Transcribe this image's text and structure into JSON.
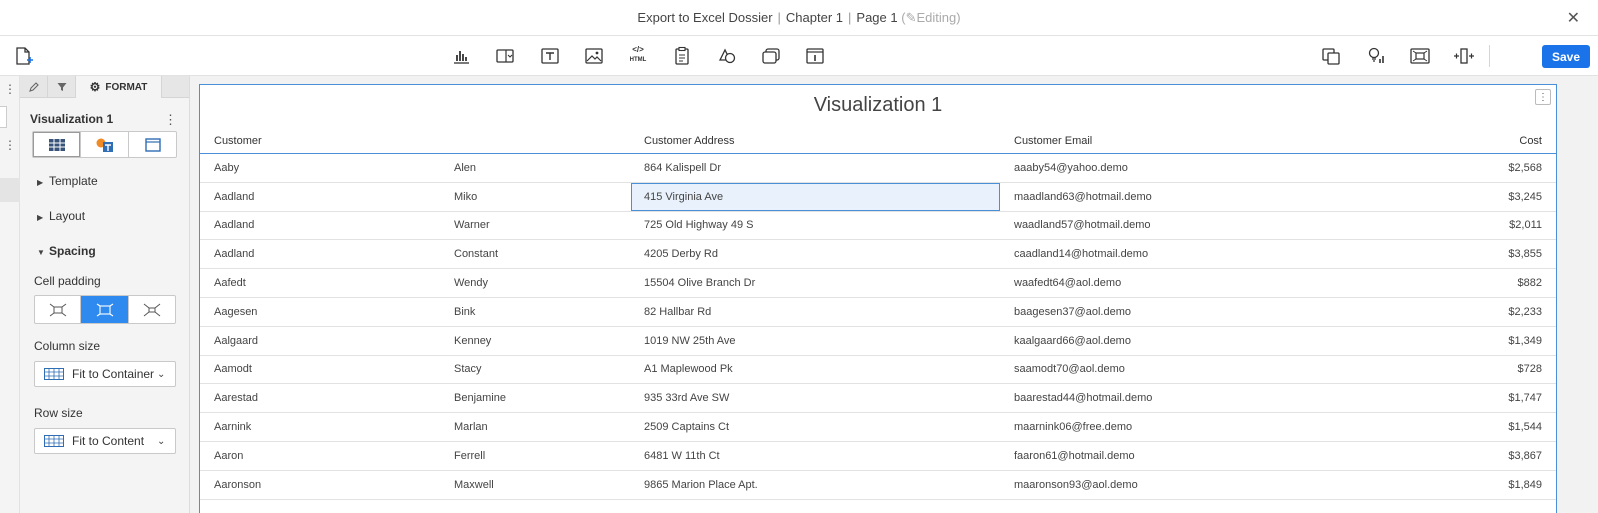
{
  "titlebar": {
    "dossier": "Export to Excel Dossier",
    "chapter": "Chapter 1",
    "page": "Page 1",
    "status": "Editing",
    "separator": "|",
    "close_icon": "close-icon"
  },
  "toolbar": {
    "save_label": "Save",
    "icons": [
      "new-page-icon",
      "chart-icon",
      "filter-selector-icon",
      "text-icon",
      "image-icon",
      "html-icon",
      "clipboard-icon",
      "shape-icon",
      "panel-stack-icon",
      "info-window-icon",
      "duplicate-icon",
      "bulb-insights-icon",
      "fit-to-window-icon",
      "insert-column-icon"
    ],
    "html_icon_text": "</>",
    "html_icon_sub": "HTML"
  },
  "panel": {
    "tabs": {
      "edit": "edit-icon",
      "filter": "filter-icon",
      "format_label": "FORMAT"
    },
    "heading": "Visualization 1",
    "more": "⋮",
    "sections": {
      "template": "Template",
      "layout": "Layout",
      "spacing": "Spacing"
    },
    "cell_padding_label": "Cell padding",
    "column_size_label": "Column size",
    "column_size_value": "Fit to Container",
    "row_size_label": "Row size",
    "row_size_value": "Fit to Content"
  },
  "viz": {
    "title": "Visualization 1",
    "more": "⋮",
    "columns": [
      "Customer",
      "",
      "Customer Address",
      "Customer Email",
      "Cost"
    ],
    "rows": [
      [
        "Aaby",
        "Alen",
        "864 Kalispell Dr",
        "aaaby54@yahoo.demo",
        "$2,568"
      ],
      [
        "Aadland",
        "Miko",
        "415 Virginia Ave",
        "maadland63@hotmail.demo",
        "$3,245"
      ],
      [
        "Aadland",
        "Warner",
        "725 Old Highway 49 S",
        "waadland57@hotmail.demo",
        "$2,011"
      ],
      [
        "Aadland",
        "Constant",
        "4205 Derby Rd",
        "caadland14@hotmail.demo",
        "$3,855"
      ],
      [
        "Aafedt",
        "Wendy",
        "15504 Olive Branch Dr",
        "waafedt64@aol.demo",
        "$882"
      ],
      [
        "Aagesen",
        "Bink",
        "82 Hallbar Rd",
        "baagesen37@aol.demo",
        "$2,233"
      ],
      [
        "Aalgaard",
        "Kenney",
        "1019 NW 25th Ave",
        "kaalgaard66@aol.demo",
        "$1,349"
      ],
      [
        "Aamodt",
        "Stacy",
        "A1 Maplewood Pk",
        "saamodt70@aol.demo",
        "$728"
      ],
      [
        "Aarestad",
        "Benjamine",
        "935 33rd Ave SW",
        "baarestad44@hotmail.demo",
        "$1,747"
      ],
      [
        "Aarnink",
        "Marlan",
        "2509 Captains Ct",
        "maarnink06@free.demo",
        "$1,544"
      ],
      [
        "Aaron",
        "Ferrell",
        "6481 W 11th Ct",
        "faaron61@hotmail.demo",
        "$3,867"
      ],
      [
        "Aaronson",
        "Maxwell",
        "9865 Marion Place Apt.",
        "maaronson93@aol.demo",
        "$1,849"
      ]
    ],
    "selected_row": 1
  },
  "colors": {
    "accent": "#1a73e8",
    "selection_border": "#4a90d9",
    "selection_fill": "#e9f2fc",
    "active_segment": "#2f8af0"
  }
}
